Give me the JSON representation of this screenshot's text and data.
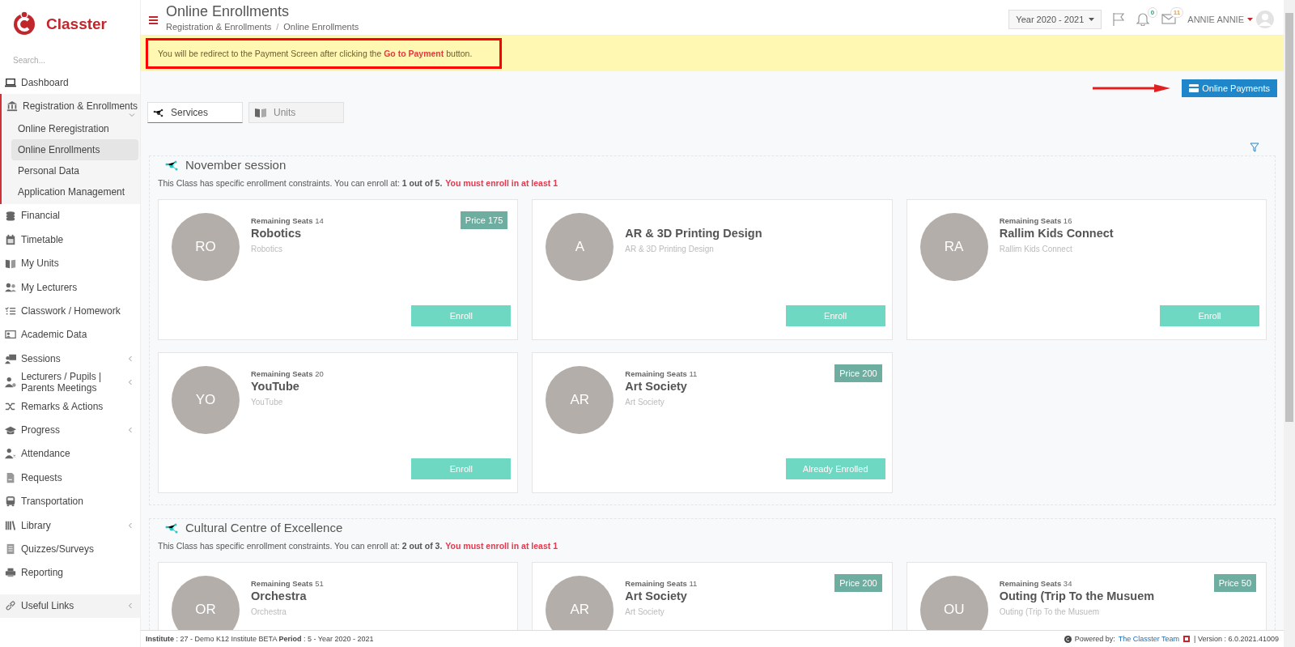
{
  "brand": {
    "name": "Classter"
  },
  "sidebar": {
    "search_placeholder": "Search...",
    "items": [
      {
        "label": "Dashboard",
        "selected": false,
        "expandable": false
      },
      {
        "label": "Registration & Enrollments",
        "selected": false,
        "expandable": true,
        "expanded": true,
        "children": [
          {
            "label": "Online Reregistration",
            "selected": false
          },
          {
            "label": "Online Enrollments",
            "selected": true
          },
          {
            "label": "Personal Data",
            "selected": false
          },
          {
            "label": "Application Management",
            "selected": false
          }
        ]
      },
      {
        "label": "Financial",
        "selected": false,
        "expandable": false
      },
      {
        "label": "Timetable",
        "selected": false,
        "expandable": false
      },
      {
        "label": "My Units",
        "selected": false,
        "expandable": false
      },
      {
        "label": "My Lecturers",
        "selected": false,
        "expandable": false
      },
      {
        "label": "Classwork / Homework",
        "selected": false,
        "expandable": false
      },
      {
        "label": "Academic Data",
        "selected": false,
        "expandable": false
      },
      {
        "label": "Sessions",
        "selected": false,
        "expandable": true,
        "expanded": false
      },
      {
        "label": "Lecturers / Pupils | Parents Meetings",
        "selected": false,
        "expandable": true,
        "expanded": false
      },
      {
        "label": "Remarks & Actions",
        "selected": false,
        "expandable": false
      },
      {
        "label": "Progress",
        "selected": false,
        "expandable": true,
        "expanded": false
      },
      {
        "label": "Attendance",
        "selected": false,
        "expandable": false
      },
      {
        "label": "Requests",
        "selected": false,
        "expandable": false
      },
      {
        "label": "Transportation",
        "selected": false,
        "expandable": false
      },
      {
        "label": "Library",
        "selected": false,
        "expandable": true,
        "expanded": false
      },
      {
        "label": "Quizzes/Surveys",
        "selected": false,
        "expandable": false
      },
      {
        "label": "Reporting",
        "selected": false,
        "expandable": false
      }
    ],
    "useful_links": {
      "label": "Useful Links",
      "expanded": false
    }
  },
  "header": {
    "title": "Online Enrollments",
    "breadcrumb": [
      "Registration & Enrollments",
      "Online Enrollments"
    ],
    "breadcrumb_separator": "/",
    "year": "Year 2020 - 2021",
    "notifications": "0",
    "messages": "11",
    "user": "ANNIE ANNIE"
  },
  "alert": {
    "text": "You will be redirect to the Payment Screen after clicking the **Go to Payment** button."
  },
  "online_payments_button": "Online Payments",
  "tabs": [
    {
      "label": "Services",
      "selected": true
    },
    {
      "label": "Units",
      "selected": false
    }
  ],
  "sessions": [
    {
      "title": "November session",
      "constraint": "This Class has specific enrollment constraints. You can enroll at: **1 out of 5.**",
      "requirement": "You must enroll in at least 1",
      "courses": [
        {
          "initials": "RO",
          "seats_label": "Remaining Seats",
          "seats": "14",
          "name": "Robotics",
          "subtitle": "Robotics",
          "price": "Price 175",
          "action": "Enroll"
        },
        {
          "initials": "A",
          "name": "AR & 3D Printing Design",
          "subtitle": "AR & 3D Printing Design",
          "action": "Enroll"
        },
        {
          "initials": "RA",
          "seats_label": "Remaining Seats",
          "seats": "16",
          "name": "Rallim Kids Connect",
          "subtitle": "Rallim Kids Connect",
          "action": "Enroll"
        },
        {
          "initials": "YO",
          "seats_label": "Remaining Seats",
          "seats": "20",
          "name": "YouTube",
          "subtitle": "YouTube",
          "action": "Enroll"
        },
        {
          "initials": "AR",
          "seats_label": "Remaining Seats",
          "seats": "11",
          "name": "Art Society",
          "subtitle": "Art Society",
          "price": "Price 200",
          "action": "Already Enrolled"
        }
      ]
    },
    {
      "title": "Cultural Centre of Excellence",
      "constraint": "This Class has specific enrollment constraints. You can enroll at: **2 out of 3.**",
      "requirement": "You must enroll in at least 1",
      "courses": [
        {
          "initials": "OR",
          "seats_label": "Remaining Seats",
          "seats": "51",
          "name": "Orchestra",
          "subtitle": "Orchestra"
        },
        {
          "initials": "AR",
          "seats_label": "Remaining Seats",
          "seats": "11",
          "name": "Art Society",
          "subtitle": "Art Society",
          "price": "Price 200"
        },
        {
          "initials": "OU",
          "seats_label": "Remaining Seats",
          "seats": "34",
          "name": "Outing (Trip To the Musuem",
          "subtitle": "Outing (Trip To the Musuem",
          "price": "Price 50"
        }
      ]
    }
  ],
  "footer": {
    "info": "**Institute** : 27 - Demo K12 Institute BETA **Period** : 5 - Year 2020 - 2021",
    "powered_by": "Powered by:",
    "team_link": "The Classter Team",
    "version": "| Version : 6.0.2021.41009"
  }
}
